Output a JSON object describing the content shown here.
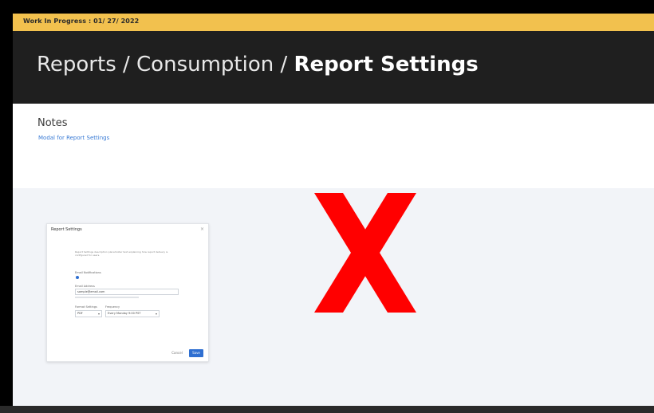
{
  "banner": {
    "text": "Work In Progress : 01/ 27/ 2022",
    "color": "#f2c14e"
  },
  "header": {
    "breadcrumb": [
      "Reports",
      "Consumption"
    ],
    "separator": " / ",
    "current": "Report Settings"
  },
  "notes": {
    "title": "Notes",
    "link": "Modal for Report Settings"
  },
  "modal": {
    "title": "Report Settings",
    "close_icon": "close-icon",
    "description": "Report Settings description placeholder text explaining how report delivery is configured for users.",
    "toggle_label": "Email Notifications",
    "email_label": "Email Address",
    "email_value": "sample@email.com",
    "format_label": "Format Settings",
    "format_value": "PDF",
    "frequency_label": "Frequency",
    "frequency_value": "Every Monday 9:00 PST",
    "cancel_label": "Cancel",
    "save_label": "Save",
    "accent": "#2f6fd1"
  },
  "overlay": {
    "icon": "red-x-mark-icon",
    "color": "#ff0000"
  }
}
